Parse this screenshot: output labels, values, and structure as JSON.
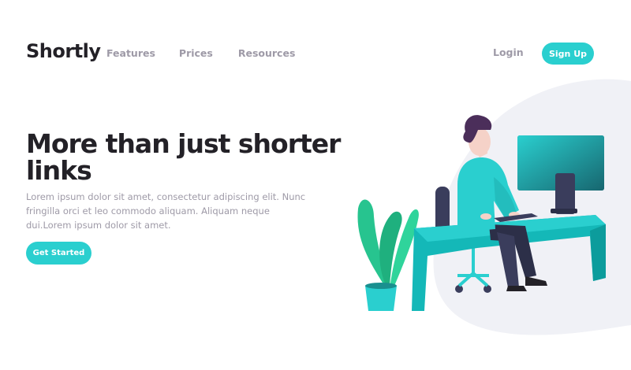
{
  "header": {
    "logo": "Shortly",
    "nav": [
      {
        "label": "Features"
      },
      {
        "label": "Prices"
      },
      {
        "label": "Resources"
      }
    ],
    "login_label": "Login",
    "signup_label": "Sign Up"
  },
  "hero": {
    "title": "More than just shorter links",
    "description": "Lorem ipsum dolor sit amet, consectetur adipiscing elit. Nunc fringilla orci et leo commodo aliquam. Aliquam neque dui.Lorem ipsum dolor sit amet.",
    "cta_label": "Get Started"
  },
  "colors": {
    "accent": "#2acfcf",
    "dark": "#232127",
    "gray": "#9e9aa7",
    "blob": "#f0f1f6"
  },
  "illustration": {
    "name": "person-working-illustration"
  }
}
